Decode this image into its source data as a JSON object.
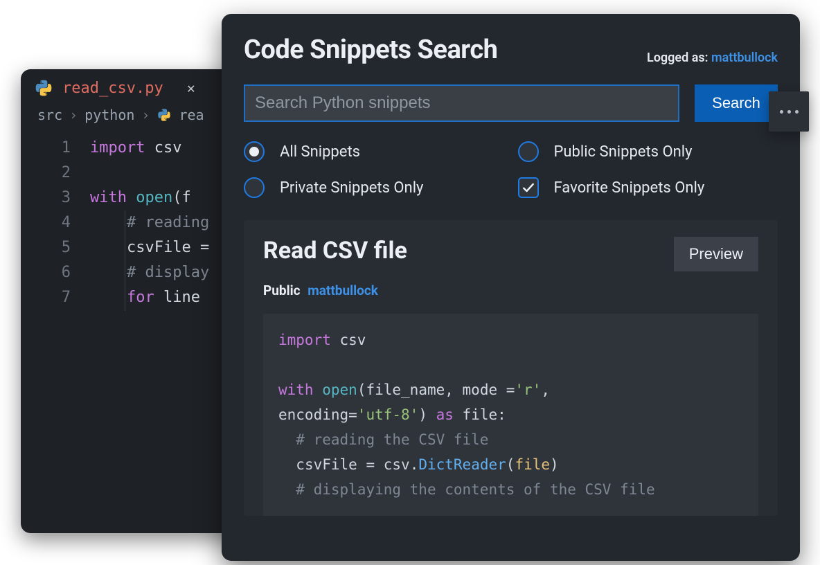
{
  "editor": {
    "tab": {
      "filename": "read_csv.py"
    },
    "breadcrumb": {
      "seg1": "src",
      "seg2": "python",
      "seg3": "rea"
    },
    "lines": {
      "l1_kw": "import",
      "l1_mod": "csv",
      "l3_kw1": "with",
      "l3_fn": "open",
      "l3_rest": "(f",
      "l4_comment": "# reading",
      "l5_var": "csvFile",
      "l5_eq": " =",
      "l6_comment": "# display",
      "l7_kw": "for",
      "l7_rest": " line"
    },
    "gutter": [
      "1",
      "2",
      "3",
      "4",
      "5",
      "6",
      "7"
    ]
  },
  "search": {
    "title": "Code Snippets Search",
    "logged_label": "Logged as: ",
    "username": "mattbullock",
    "placeholder": "Search Python snippets",
    "button": "Search",
    "filters": {
      "all": "All Snippets",
      "public": "Public Snippets Only",
      "private": "Private Snippets Only",
      "favorite": "Favorite Snippets Only"
    },
    "result": {
      "title": "Read CSV file",
      "preview": "Preview",
      "visibility": "Public",
      "owner": "mattbullock"
    },
    "snippet": {
      "l1_kw": "import",
      "l1_mod": "csv",
      "l3_kw1": "with",
      "l3_fn": "open",
      "l3_p1": "(file_name",
      "l3_p2": ", mode =",
      "l3_str1": "'r'",
      "l3_p3": ",",
      "l4_p1": "encoding=",
      "l4_str1": "'utf-8'",
      "l4_p2": ")",
      "l4_kw": " as",
      "l4_var": " file",
      "l4_colon": ":",
      "l5_comment": "# reading the CSV file",
      "l6_var": "csvFile",
      "l6_eq": " = ",
      "l6_mod": "csv",
      "l6_dot": ".",
      "l6_cls": "DictReader",
      "l6_p1": "(",
      "l6_arg": "file",
      "l6_p2": ")",
      "l7_comment": "# displaying the contents of the CSV file"
    }
  }
}
